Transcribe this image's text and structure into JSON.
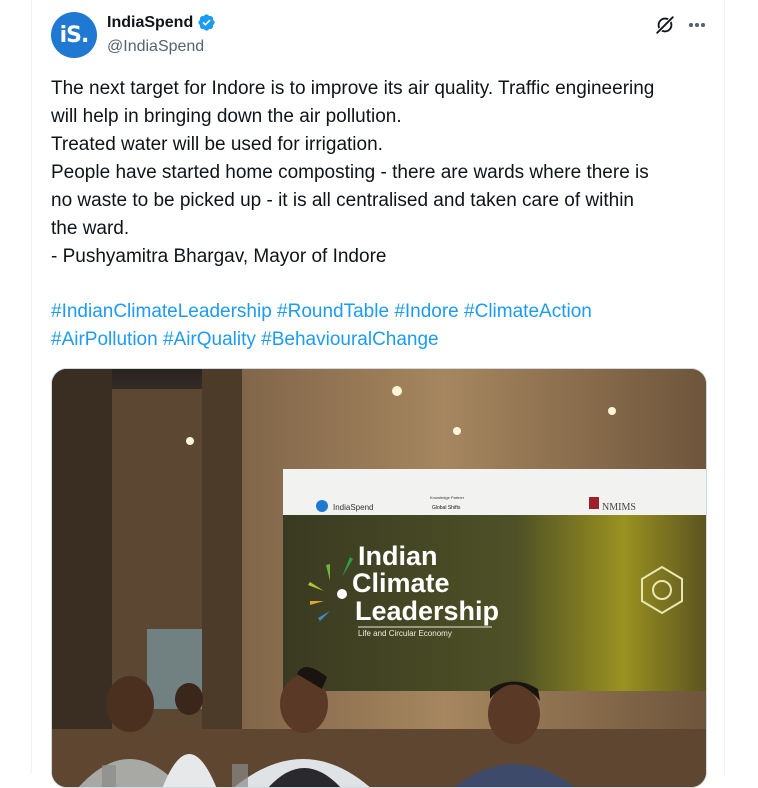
{
  "account": {
    "name": "IndiaSpend",
    "handle": "@IndiaSpend",
    "avatar_text": "iS."
  },
  "tweet": {
    "lines": [
      "The next target for Indore is to improve its air quality. Traffic engineering",
      "will help in bringing down the air pollution.",
      "Treated water will be used for irrigation.",
      "People have started home composting - there are wards where there is",
      "no waste to be picked up - it is all centralised and taken care of within",
      "the ward.",
      "- Pushyamitra Bhargav, Mayor of Indore"
    ],
    "hashtag_lines": [
      [
        "#IndianClimateLeadership",
        "#RoundTable",
        "#Indore",
        "#ClimateAction"
      ],
      [
        "#AirPollution",
        "#AirQuality",
        "#BehaviouralChange"
      ]
    ]
  },
  "media": {
    "banner_title_1": "Indian",
    "banner_title_2": "Climate",
    "banner_title_3": "Leadership",
    "banner_subtitle": "Life and Circular Economy",
    "banner_logo_left": "IndiaSpend",
    "banner_logo_mid_1": "Knowledge Partner",
    "banner_logo_mid_2": "Global Shifts",
    "banner_logo_right": "NMIMS"
  },
  "icons": {
    "verified": "verified-badge-icon",
    "grok": "grok-icon",
    "more": "more-icon"
  },
  "colors": {
    "link": "#1d9bf0",
    "verified": "#1d9bf0",
    "avatar_bg": "#1f78d1"
  }
}
